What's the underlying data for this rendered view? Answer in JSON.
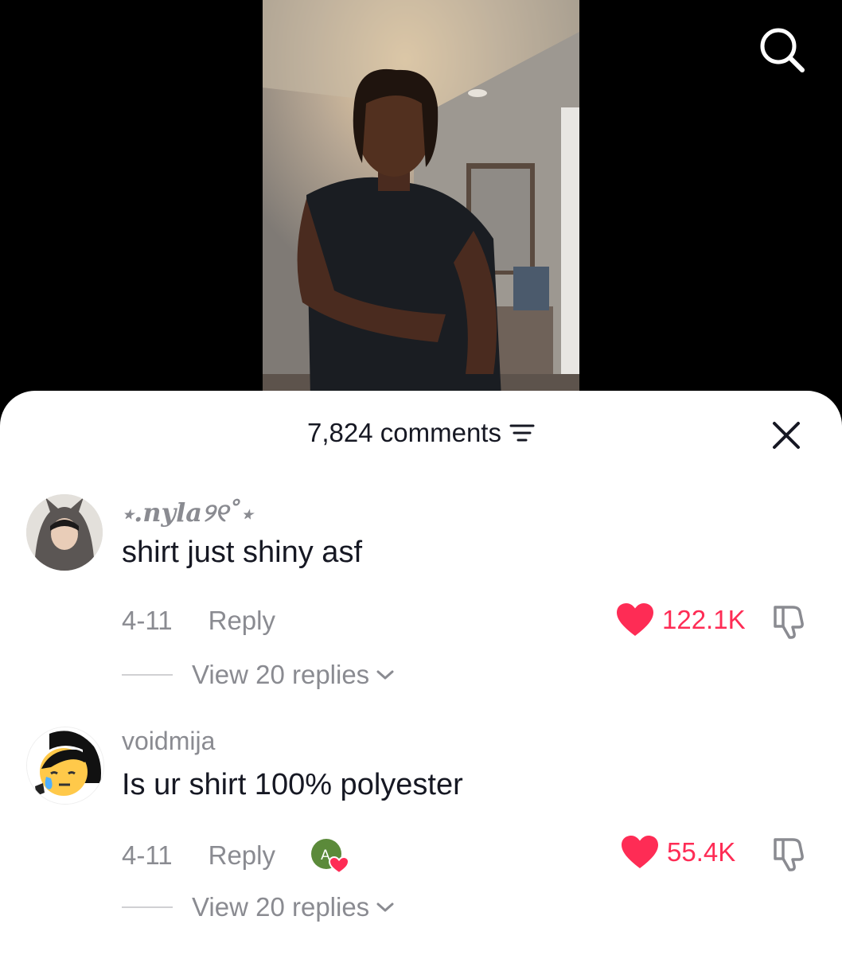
{
  "header": {
    "comment_count": "7,824 comments",
    "search_icon": "search-icon",
    "filter_icon": "filter-icon",
    "close_icon": "close-icon"
  },
  "colors": {
    "like_red": "#fe2c55",
    "muted_text": "#8a8b91",
    "primary_text": "#161823"
  },
  "comments": [
    {
      "username": "⋆.𝒏𝒚𝒍𝒂୨୧˚⋆",
      "text": "shirt just shiny asf",
      "date": "4-11",
      "reply_label": "Reply",
      "likes": "122.1K",
      "liked": true,
      "view_replies": "View 20 replies",
      "creator_liked": false
    },
    {
      "username": "voidmija",
      "text": "Is ur shirt 100% polyester",
      "date": "4-11",
      "reply_label": "Reply",
      "likes": "55.4K",
      "liked": true,
      "view_replies": "View 20 replies",
      "creator_liked": true
    }
  ]
}
